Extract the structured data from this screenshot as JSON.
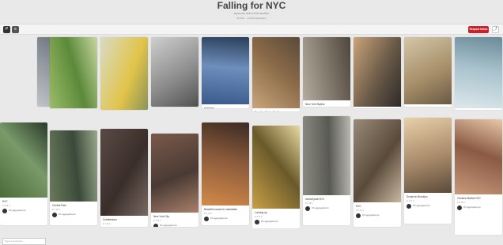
{
  "board": {
    "title": "Falling for NYC",
    "subtitle": "September 2013 PYPR Headliner",
    "stats": "30 Pins · 1,078 Impressions",
    "follow_label": "Request follow"
  },
  "pins": [
    {
      "id": "p1",
      "desc": "Brooklyn bridge",
      "meta": "♥ 5   ★ 4",
      "attr": "Pin aggregated pin",
      "colors": [
        "#c9cdd2",
        "#8d939a",
        "#5a5f66"
      ]
    },
    {
      "id": "p2",
      "desc": "NYC, Central Park in Spring",
      "meta": "♥ 3   ★ 7",
      "attr": "Pin aggregated pin",
      "colors": [
        "#9fbf6a",
        "#5b8a3a",
        "#c8d6a0"
      ]
    },
    {
      "id": "p3",
      "desc": "Causing it at the ny - lifeisBusy, by Ditty Perfect",
      "meta": "♥ 8   ★ 7",
      "attr": "Pin aggregated pin",
      "colors": [
        "#d7dbc5",
        "#e2c44a",
        "#7a8a5a"
      ]
    },
    {
      "id": "p4",
      "desc": "You'll see if this city",
      "meta": "♥ 6   ★ 2",
      "attr": "Pin aggregated pin",
      "colors": [
        "#cfcfcf",
        "#8b8b8b",
        "#4a4a4a"
      ]
    },
    {
      "id": "p5",
      "desc": "evenings",
      "meta": "♥ 4   ★ 3",
      "attr": "Pin aggregated pin",
      "colors": [
        "#3a5a8c",
        "#6e8ebc",
        "#2a3e5a"
      ]
    },
    {
      "id": "p6",
      "desc": "Brooklyn Bridge Traffic",
      "meta": "♥ 2   ★ 9",
      "attr": "Pin aggregated pin",
      "colors": [
        "#c9a57a",
        "#8a6a48",
        "#5a4a3a"
      ]
    },
    {
      "id": "p7",
      "desc": "New York Skyline",
      "meta": "♥ 4   ★ 4",
      "attr": "Pin aggregated pin",
      "colors": [
        "#b5aca0",
        "#7d7468",
        "#4e463c"
      ]
    },
    {
      "id": "p8",
      "desc": "Reflection | New York",
      "meta": "♥ 3   ★ 5",
      "attr": "Pin aggregated pin",
      "colors": [
        "#c9a47a",
        "#6a5a48",
        "#2e2a28"
      ]
    },
    {
      "id": "p9",
      "desc": "NYC",
      "meta": "♥ 5   ★ 3",
      "attr": "Pin aggregated pin",
      "colors": [
        "#d4c6a8",
        "#a8906a",
        "#6a5a44"
      ]
    },
    {
      "id": "p10",
      "desc": "Lady Liberty",
      "meta": "♥ 6   ★ 8",
      "attr": "Pin aggregated pin",
      "colors": [
        "#dde8ec",
        "#a8c2cc",
        "#6a8a98"
      ]
    },
    {
      "id": "p11",
      "desc": "NYC",
      "meta": "♥ 3   ★ 3",
      "attr": "Pin aggregated pin",
      "colors": [
        "#4a6a3a",
        "#7a9a6a",
        "#2a3a2a"
      ]
    },
    {
      "id": "p12",
      "desc": "Central Park",
      "meta": "♥ 2   ★ 4",
      "attr": "Pin aggregated pin",
      "colors": [
        "#6a7a5a",
        "#3a4a3a",
        "#9aa88a"
      ]
    },
    {
      "id": "p13",
      "desc": "Cobblestone",
      "meta": "♥ 1   ★ 2",
      "attr": "Pin aggregated pin",
      "colors": [
        "#5a4a44",
        "#3a2e2a",
        "#7a6a62"
      ]
    },
    {
      "id": "p14",
      "desc": "New York City",
      "meta": "♥ 4   ★ 4",
      "attr": "Pin aggregated pin",
      "colors": [
        "#7a5a4a",
        "#4a3a34",
        "#a8806a"
      ]
    },
    {
      "id": "p15",
      "desc": "Beautiful sunset in manhattan",
      "meta": "♥ 2   ★ 3",
      "attr": "Pin aggregated pin",
      "colors": [
        "#d48a4a",
        "#8a5a3a",
        "#3a2a24"
      ]
    },
    {
      "id": "p16",
      "desc": "Looking up",
      "meta": "♥ 3   ★ 5",
      "attr": "Pin aggregated pin",
      "colors": [
        "#c8a048",
        "#6a5a2a",
        "#e8d8a0"
      ]
    },
    {
      "id": "p17",
      "desc": "central park NYC",
      "meta": "♥ 2   ★ 1",
      "attr": "Pin aggregated pin",
      "colors": [
        "#8a8a82",
        "#5a5a54",
        "#b8b8b0"
      ]
    },
    {
      "id": "p18",
      "desc": "NYC",
      "meta": "♥ 3   ★ 3",
      "attr": "Pin aggregated pin",
      "colors": [
        "#9a8a7a",
        "#5a4a3a",
        "#c8b8a0"
      ]
    },
    {
      "id": "p19",
      "desc": "Sunset in Brooklyn",
      "meta": "♥ 4   ★ 2",
      "attr": "Pin aggregated pin",
      "colors": [
        "#e8d0a8",
        "#a88a6a",
        "#5a4a3a"
      ]
    },
    {
      "id": "p20",
      "desc": "Chelsea Market NYC",
      "meta": "♥ 2   ★ 6",
      "attr": "Pin aggregated pin",
      "colors": [
        "#c89a7a",
        "#8a5a44",
        "#e8c8a8"
      ]
    }
  ],
  "footer": {
    "input_placeholder": "Type a comment..."
  }
}
